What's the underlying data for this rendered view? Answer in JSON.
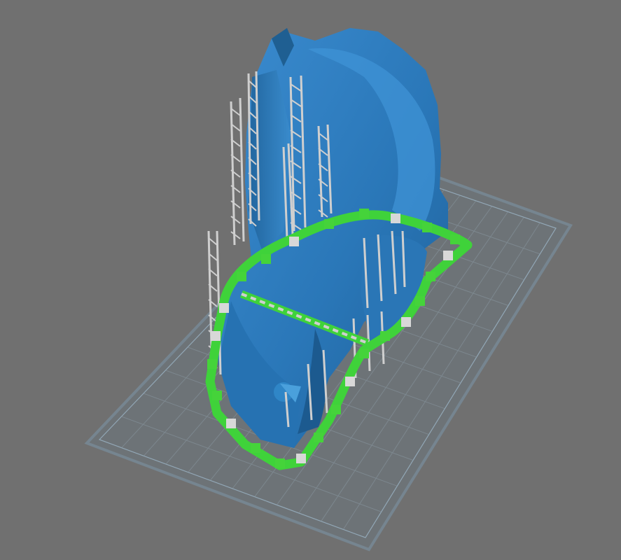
{
  "viewport": {
    "label": "",
    "background": "#707070",
    "colors": {
      "model": "#2f7fbf",
      "model_dark": "#1f5f92",
      "model_light": "#4b9bd6",
      "supports": "#c9c9c9",
      "contact": "#45d33a",
      "bed_outline": "#6f8ea6",
      "bed_grid": "#7e8b94"
    }
  },
  "scene": {
    "objects": [
      {
        "name": "print-bed",
        "icon": "grid-plane"
      },
      {
        "name": "model",
        "icon": "mesh"
      },
      {
        "name": "support-lattice",
        "icon": "supports"
      },
      {
        "name": "first-layer-raft",
        "icon": "contact-layer"
      }
    ]
  }
}
